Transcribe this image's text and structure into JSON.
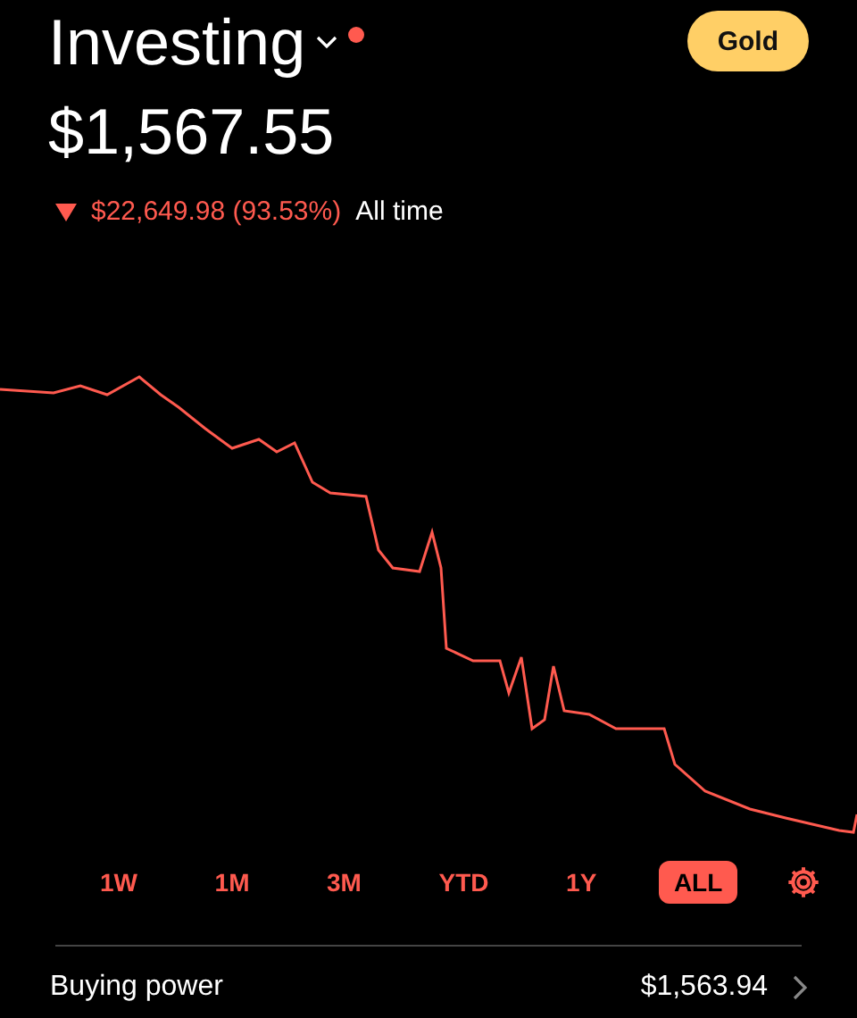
{
  "header": {
    "title": "Investing",
    "notification_dot": true,
    "badge": "Gold"
  },
  "portfolio": {
    "value": "$1,567.55",
    "change_down": true,
    "change": "$22,649.98 (93.53%)",
    "period": "All time"
  },
  "ranges": [
    {
      "label": "1W",
      "selected": false
    },
    {
      "label": "1M",
      "selected": false
    },
    {
      "label": "3M",
      "selected": false
    },
    {
      "label": "YTD",
      "selected": false
    },
    {
      "label": "1Y",
      "selected": false
    },
    {
      "label": "ALL",
      "selected": true
    }
  ],
  "buying_power": {
    "label": "Buying power",
    "value": "$1,563.94"
  }
}
